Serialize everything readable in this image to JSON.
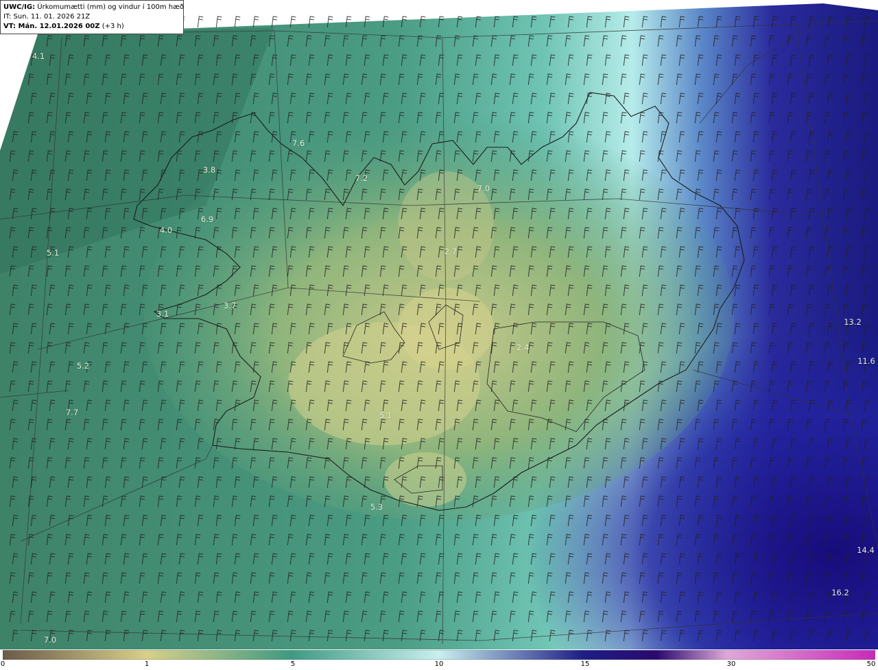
{
  "info": {
    "model": "UWC/IG:",
    "title": "Úrkomumætti (mm) og vindur í 100m hæð",
    "it": "IT: Sun. 11. 01. 2026 21Z",
    "vt_label": "VT: Mán. 12.01.2026 00Z",
    "vt_offset": "(+3 h)"
  },
  "values": [
    {
      "id": "val-41",
      "text": "4.1"
    },
    {
      "id": "val-38",
      "text": "3.8"
    },
    {
      "id": "val-76",
      "text": "7.6"
    },
    {
      "id": "val-72",
      "text": "7.2"
    },
    {
      "id": "val-70a",
      "text": "7.0"
    },
    {
      "id": "val-40",
      "text": "4.0"
    },
    {
      "id": "val-69",
      "text": "6.9"
    },
    {
      "id": "val-51a",
      "text": "5.1"
    },
    {
      "id": "val-27",
      "text": "2.7"
    },
    {
      "id": "val-37",
      "text": "3.7"
    },
    {
      "id": "val-31",
      "text": "3.1"
    },
    {
      "id": "val-52",
      "text": "5.2"
    },
    {
      "id": "val-24",
      "text": "2.4"
    },
    {
      "id": "val-132",
      "text": "13.2"
    },
    {
      "id": "val-116",
      "text": "11.6"
    },
    {
      "id": "val-77",
      "text": "7.7"
    },
    {
      "id": "val-51b",
      "text": "5.1"
    },
    {
      "id": "val-53",
      "text": "5.3"
    },
    {
      "id": "val-144",
      "text": "14.4"
    },
    {
      "id": "val-162",
      "text": "16.2"
    },
    {
      "id": "val-70b",
      "text": "7.0"
    }
  ],
  "colorbar": {
    "ticks": [
      "0",
      "1",
      "5",
      "10",
      "15",
      "30",
      "50"
    ],
    "colors": [
      "#6b5a4a",
      "#d8d08a",
      "#3f9a82",
      "#c8f0ee",
      "#1e1e86",
      "#2a0a70",
      "#e0a8d8",
      "#c82ab8"
    ]
  }
}
